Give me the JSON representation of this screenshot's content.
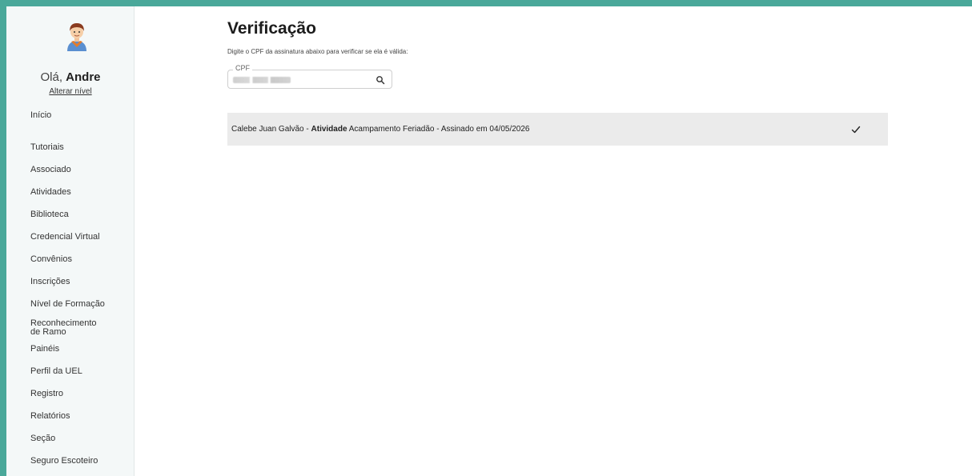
{
  "user": {
    "greeting_prefix": "Olá,",
    "name": "Andre",
    "change_level": "Alterar nível"
  },
  "sidebar": {
    "items": [
      {
        "label": "Início"
      },
      {
        "label": "Tutoriais"
      },
      {
        "label": "Associado"
      },
      {
        "label": "Atividades"
      },
      {
        "label": "Biblioteca"
      },
      {
        "label": "Credencial Virtual"
      },
      {
        "label": "Convênios"
      },
      {
        "label": "Inscrições"
      },
      {
        "label": "Nível de Formação"
      },
      {
        "label": "Reconhecimento de Ramo"
      },
      {
        "label": "Painéis"
      },
      {
        "label": "Perfil da UEL"
      },
      {
        "label": "Registro"
      },
      {
        "label": "Relatórios"
      },
      {
        "label": "Seção"
      },
      {
        "label": "Seguro Escoteiro"
      }
    ]
  },
  "main": {
    "title": "Verificação",
    "subtitle": "Digite o CPF da assinatura abaixo para verificar se ela é válida:",
    "cpf_label": "CPF",
    "search_icon": "search-icon"
  },
  "result": {
    "name": "Calebe Juan Galvão",
    "sep1": " - ",
    "activity_label": "Atividade",
    "activity_name": " Acampamento Feriadão",
    "sep2": " - ",
    "signed_text": "Assinado em 04/05/2026",
    "status_icon": "check-icon"
  },
  "colors": {
    "accent": "#4aa89a",
    "sidebar_bg": "#f4f8f8",
    "row_bg": "#ebebeb"
  }
}
